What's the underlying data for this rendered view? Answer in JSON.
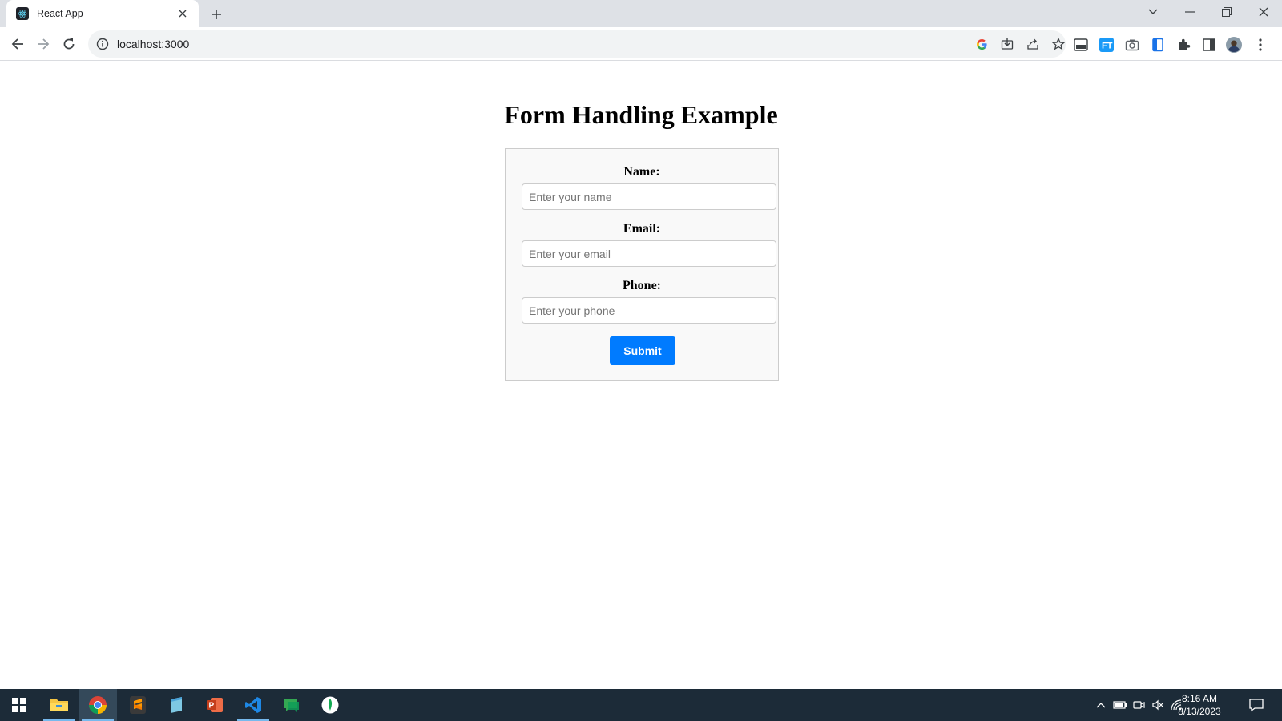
{
  "browser": {
    "tab": {
      "title": "React App"
    },
    "url": "localhost:3000"
  },
  "page": {
    "heading": "Form Handling Example",
    "form": {
      "fields": [
        {
          "label": "Name:",
          "placeholder": "Enter your name",
          "value": ""
        },
        {
          "label": "Email:",
          "placeholder": "Enter your email",
          "value": ""
        },
        {
          "label": "Phone:",
          "placeholder": "Enter your phone",
          "value": ""
        }
      ],
      "submit_label": "Submit"
    }
  },
  "taskbar": {
    "apps": [
      "start",
      "file-explorer",
      "chrome",
      "sublime-text",
      "notepad",
      "powerpoint",
      "vscode",
      "chat",
      "mongodb-compass"
    ],
    "clock": {
      "time": "8:16 AM",
      "date": "8/13/2023"
    }
  },
  "colors": {
    "accent": "#007bff",
    "taskbar": "#1c2b38",
    "tabstrip": "#dee1e6",
    "form_bg": "#f9f9f9"
  }
}
